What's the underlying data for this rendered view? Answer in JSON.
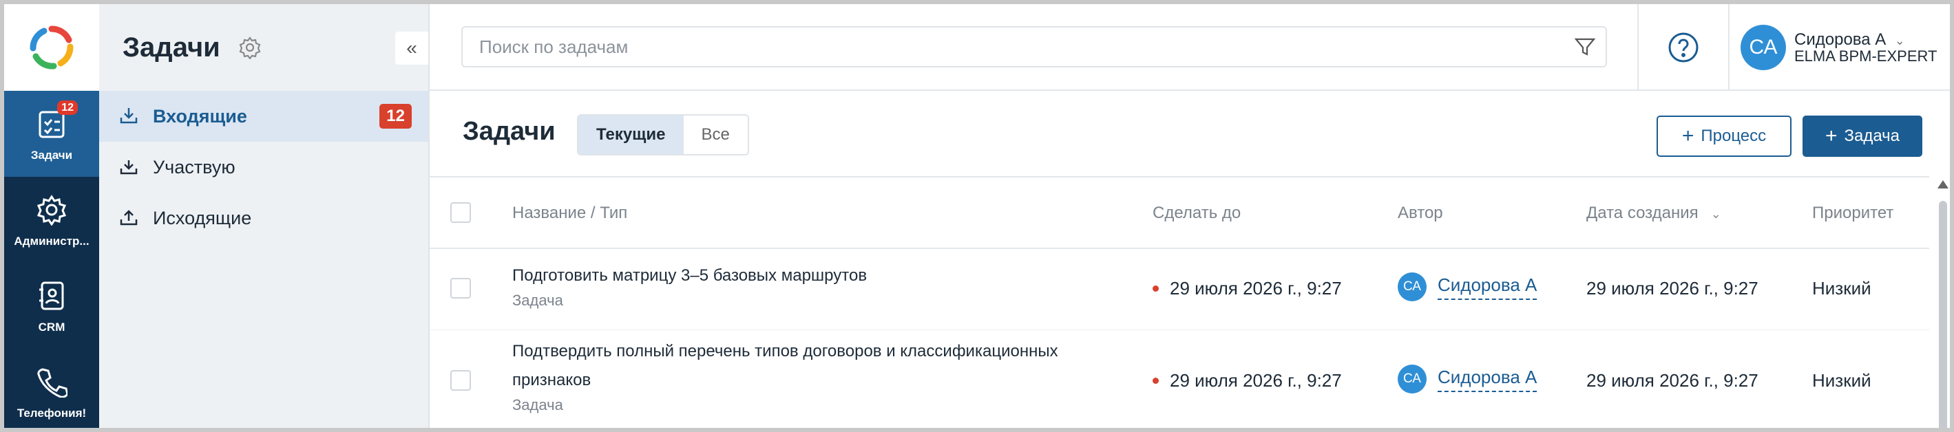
{
  "rail": {
    "items": [
      {
        "label": "Задачи",
        "badge": "12",
        "icon": "tasks-icon"
      },
      {
        "label": "Администр...",
        "icon": "gear-icon"
      },
      {
        "label": "CRM",
        "icon": "contact-book-icon"
      },
      {
        "label": "Телефония!",
        "icon": "phone-icon"
      }
    ]
  },
  "sidebar": {
    "title": "Задачи",
    "collapse_label": "«",
    "items": [
      {
        "label": "Входящие",
        "count": "12"
      },
      {
        "label": "Участвую"
      },
      {
        "label": "Исходящие"
      }
    ]
  },
  "topbar": {
    "search_placeholder": "Поиск по задачам",
    "user": {
      "initials": "СА",
      "name": "Сидорова А",
      "role": "ELMA BPM-EXPERT",
      "chevron": "⌄"
    }
  },
  "main": {
    "title": "Задачи",
    "tabs": [
      {
        "label": "Текущие",
        "active": true
      },
      {
        "label": "Все",
        "active": false
      }
    ],
    "buttons": {
      "process": "Процесс",
      "task": "Задача",
      "plus": "+"
    },
    "columns": {
      "name": "Название / Тип",
      "due": "Сделать до",
      "author": "Автор",
      "created": "Дата создания",
      "priority": "Приоритет",
      "sort_chevron": "⌄"
    },
    "rows": [
      {
        "name": "Подготовить матрицу 3–5 базовых маршрутов",
        "type": "Задача",
        "due": "29 июля 2026 г., 9:27",
        "author_initials": "СА",
        "author": "Сидорова А",
        "created": "29 июля 2026 г., 9:27",
        "priority": "Низкий"
      },
      {
        "name": "Подтвердить полный перечень типов договоров и классификационных признаков",
        "type": "Задача",
        "due": "29 июля 2026 г., 9:27",
        "author_initials": "СА",
        "author": "Сидорова А",
        "created": "29 июля 2026 г., 9:27",
        "priority": "Низкий"
      }
    ]
  },
  "colors": {
    "rail_bg": "#0f2e4c",
    "rail_active": "#1f5f95",
    "accent": "#1b5c92",
    "badge": "#d8412c",
    "avatar": "#2f8fd6"
  }
}
